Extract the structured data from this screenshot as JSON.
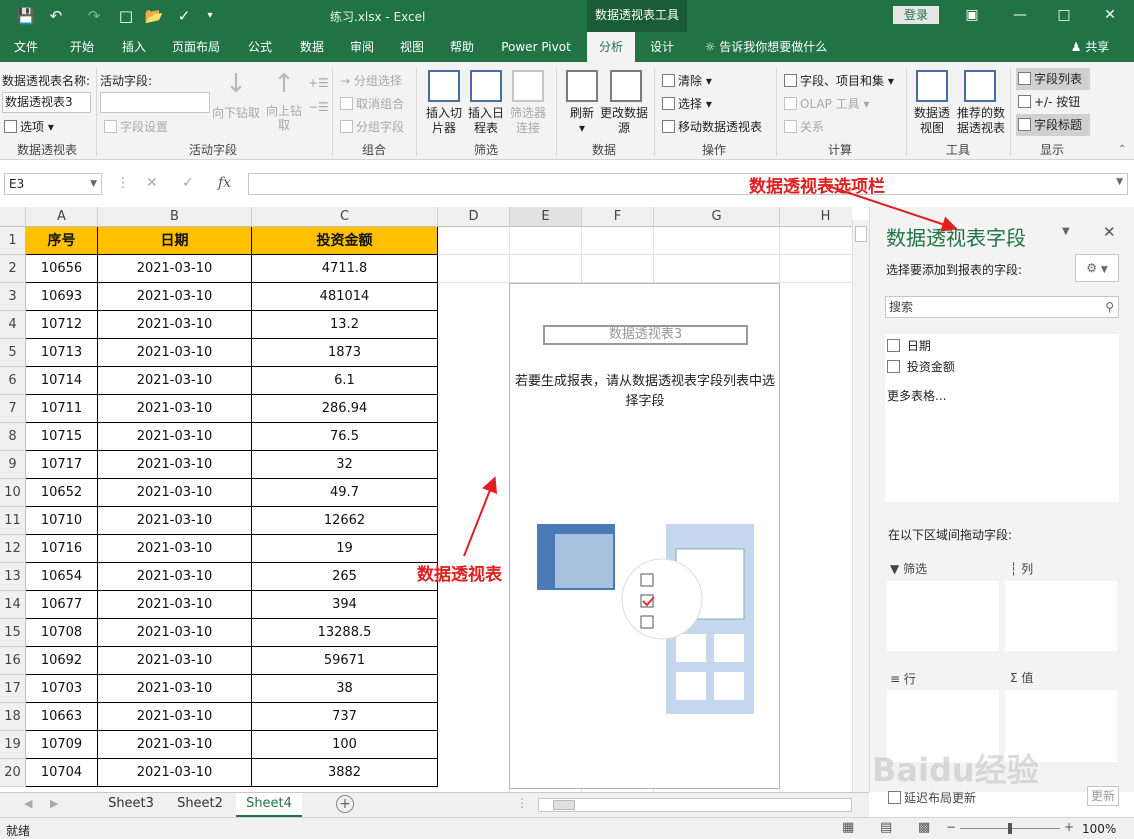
{
  "titlebar": {
    "doc_title": "练习.xlsx  -  Excel",
    "context_tab_title": "数据透视表工具",
    "login": "登录",
    "share": "共享"
  },
  "tabs": [
    "文件",
    "开始",
    "插入",
    "页面布局",
    "公式",
    "数据",
    "审阅",
    "视图",
    "帮助",
    "Power Pivot",
    "分析",
    "设计"
  ],
  "tell_me": "告诉我你想要做什么",
  "ribbon": {
    "pivot_name_label": "数据透视表名称:",
    "pivot_name_value": "数据透视表3",
    "options": "选项",
    "group_pivot": "数据透视表",
    "active_field_label": "活动字段:",
    "field_settings": "字段设置",
    "drill_down": "向下钻取",
    "drill_up": "向上钻取",
    "group_active": "活动字段",
    "group_selection": "分组选择",
    "ungroup": "取消组合",
    "group_field": "分组字段",
    "group_group": "组合",
    "insert_slicer": "插入切片器",
    "insert_timeline": "插入日程表",
    "filter_conn": "筛选器连接",
    "group_filter": "筛选",
    "refresh": "刷新",
    "change_source": "更改数据源",
    "group_data": "数据",
    "clear": "清除",
    "select": "选择",
    "move_pivot": "移动数据透视表",
    "group_actions": "操作",
    "fields_items": "字段、项目和集",
    "olap": "OLAP 工具",
    "relations": "关系",
    "group_calc": "计算",
    "pivot_chart": "数据透视图",
    "recommended": "推荐的数据透视表",
    "group_tools": "工具",
    "field_list": "字段列表",
    "buttons": "+/- 按钮",
    "field_headers": "字段标题",
    "group_show": "显示"
  },
  "namebox": "E3",
  "columns": [
    "A",
    "B",
    "C",
    "D",
    "E",
    "F",
    "G",
    "H"
  ],
  "headers": [
    "序号",
    "日期",
    "投资金额"
  ],
  "rows": [
    [
      "10656",
      "2021-03-10",
      "4711.8"
    ],
    [
      "10693",
      "2021-03-10",
      "481014"
    ],
    [
      "10712",
      "2021-03-10",
      "13.2"
    ],
    [
      "10713",
      "2021-03-10",
      "1873"
    ],
    [
      "10714",
      "2021-03-10",
      "6.1"
    ],
    [
      "10711",
      "2021-03-10",
      "286.94"
    ],
    [
      "10715",
      "2021-03-10",
      "76.5"
    ],
    [
      "10717",
      "2021-03-10",
      "32"
    ],
    [
      "10652",
      "2021-03-10",
      "49.7"
    ],
    [
      "10710",
      "2021-03-10",
      "12662"
    ],
    [
      "10716",
      "2021-03-10",
      "19"
    ],
    [
      "10654",
      "2021-03-10",
      "265"
    ],
    [
      "10677",
      "2021-03-10",
      "394"
    ],
    [
      "10708",
      "2021-03-10",
      "13288.5"
    ],
    [
      "10692",
      "2021-03-10",
      "59671"
    ],
    [
      "10703",
      "2021-03-10",
      "38"
    ],
    [
      "10663",
      "2021-03-10",
      "737"
    ],
    [
      "10709",
      "2021-03-10",
      "100"
    ],
    [
      "10704",
      "2021-03-10",
      "3882"
    ]
  ],
  "row_numbers": [
    "1",
    "2",
    "3",
    "4",
    "5",
    "6",
    "7",
    "8",
    "9",
    "10",
    "11",
    "12",
    "13",
    "14",
    "15",
    "16",
    "17",
    "18",
    "19",
    "20"
  ],
  "pivot": {
    "name": "数据透视表3",
    "hint": "若要生成报表，请从数据透视表字段列表中选择字段"
  },
  "panel": {
    "title": "数据透视表字段",
    "subtitle": "选择要添加到报表的字段:",
    "search_placeholder": "搜索",
    "fields": [
      "日期",
      "投资金额"
    ],
    "more_tables": "更多表格...",
    "drag_label": "在以下区域间拖动字段:",
    "area_filter": "筛选",
    "area_columns": "列",
    "area_rows": "行",
    "area_values": "值",
    "defer": "延迟布局更新",
    "update": "更新"
  },
  "sheets": [
    "Sheet3",
    "Sheet2",
    "Sheet4"
  ],
  "status": {
    "ready": "就绪",
    "zoom": "100%"
  },
  "annotations": {
    "options_bar": "数据透视表选项栏",
    "pivot_table": "数据透视表"
  },
  "watermark": "Baidu经验",
  "colors": {
    "accent": "#217346",
    "header_fill": "#ffc000",
    "annotation": "#e02020"
  }
}
